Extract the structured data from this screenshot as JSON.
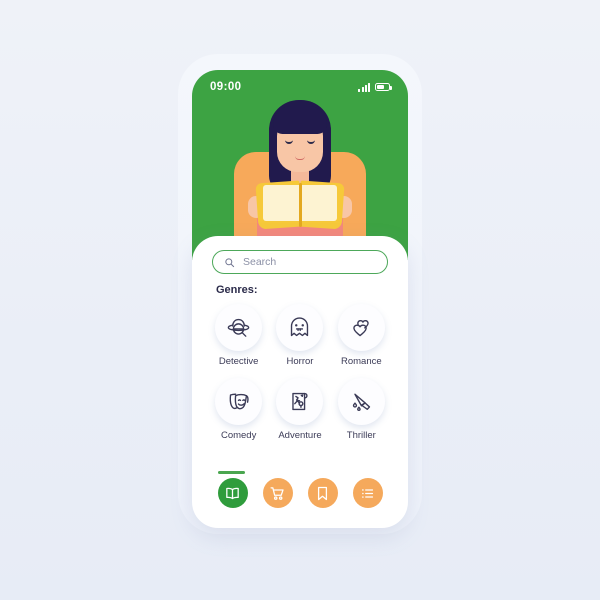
{
  "app": {
    "screen_name": "book-genres-screen",
    "colors": {
      "page_bg": "#eef1f8",
      "header_green": "#3da343",
      "accent_green": "#2f9c3c",
      "accent_orange": "#f5a95c",
      "icon_navy": "#3b3b57",
      "card_white": "#ffffff"
    }
  },
  "status_bar": {
    "time": "09:00",
    "signal_icon": "signal-bars-icon",
    "battery_icon": "battery-icon"
  },
  "hero": {
    "illustration_name": "woman-reading-book-illustration"
  },
  "search": {
    "placeholder": "Search",
    "value": "",
    "icon": "search-icon"
  },
  "genres_section": {
    "title": "Genres:",
    "items": [
      {
        "label": "Detective",
        "icon": "detective-hat-magnifier-icon"
      },
      {
        "label": "Horror",
        "icon": "ghost-icon"
      },
      {
        "label": "Romance",
        "icon": "hearts-icon"
      },
      {
        "label": "Comedy",
        "icon": "theater-masks-icon"
      },
      {
        "label": "Adventure",
        "icon": "treasure-map-icon"
      },
      {
        "label": "Thriller",
        "icon": "knife-icon"
      }
    ]
  },
  "bottom_nav": {
    "items": [
      {
        "name": "library",
        "icon": "open-book-icon",
        "active": true
      },
      {
        "name": "cart",
        "icon": "shopping-cart-icon",
        "active": false
      },
      {
        "name": "bookmarks",
        "icon": "bookmark-icon",
        "active": false
      },
      {
        "name": "list",
        "icon": "list-icon",
        "active": false
      }
    ]
  }
}
